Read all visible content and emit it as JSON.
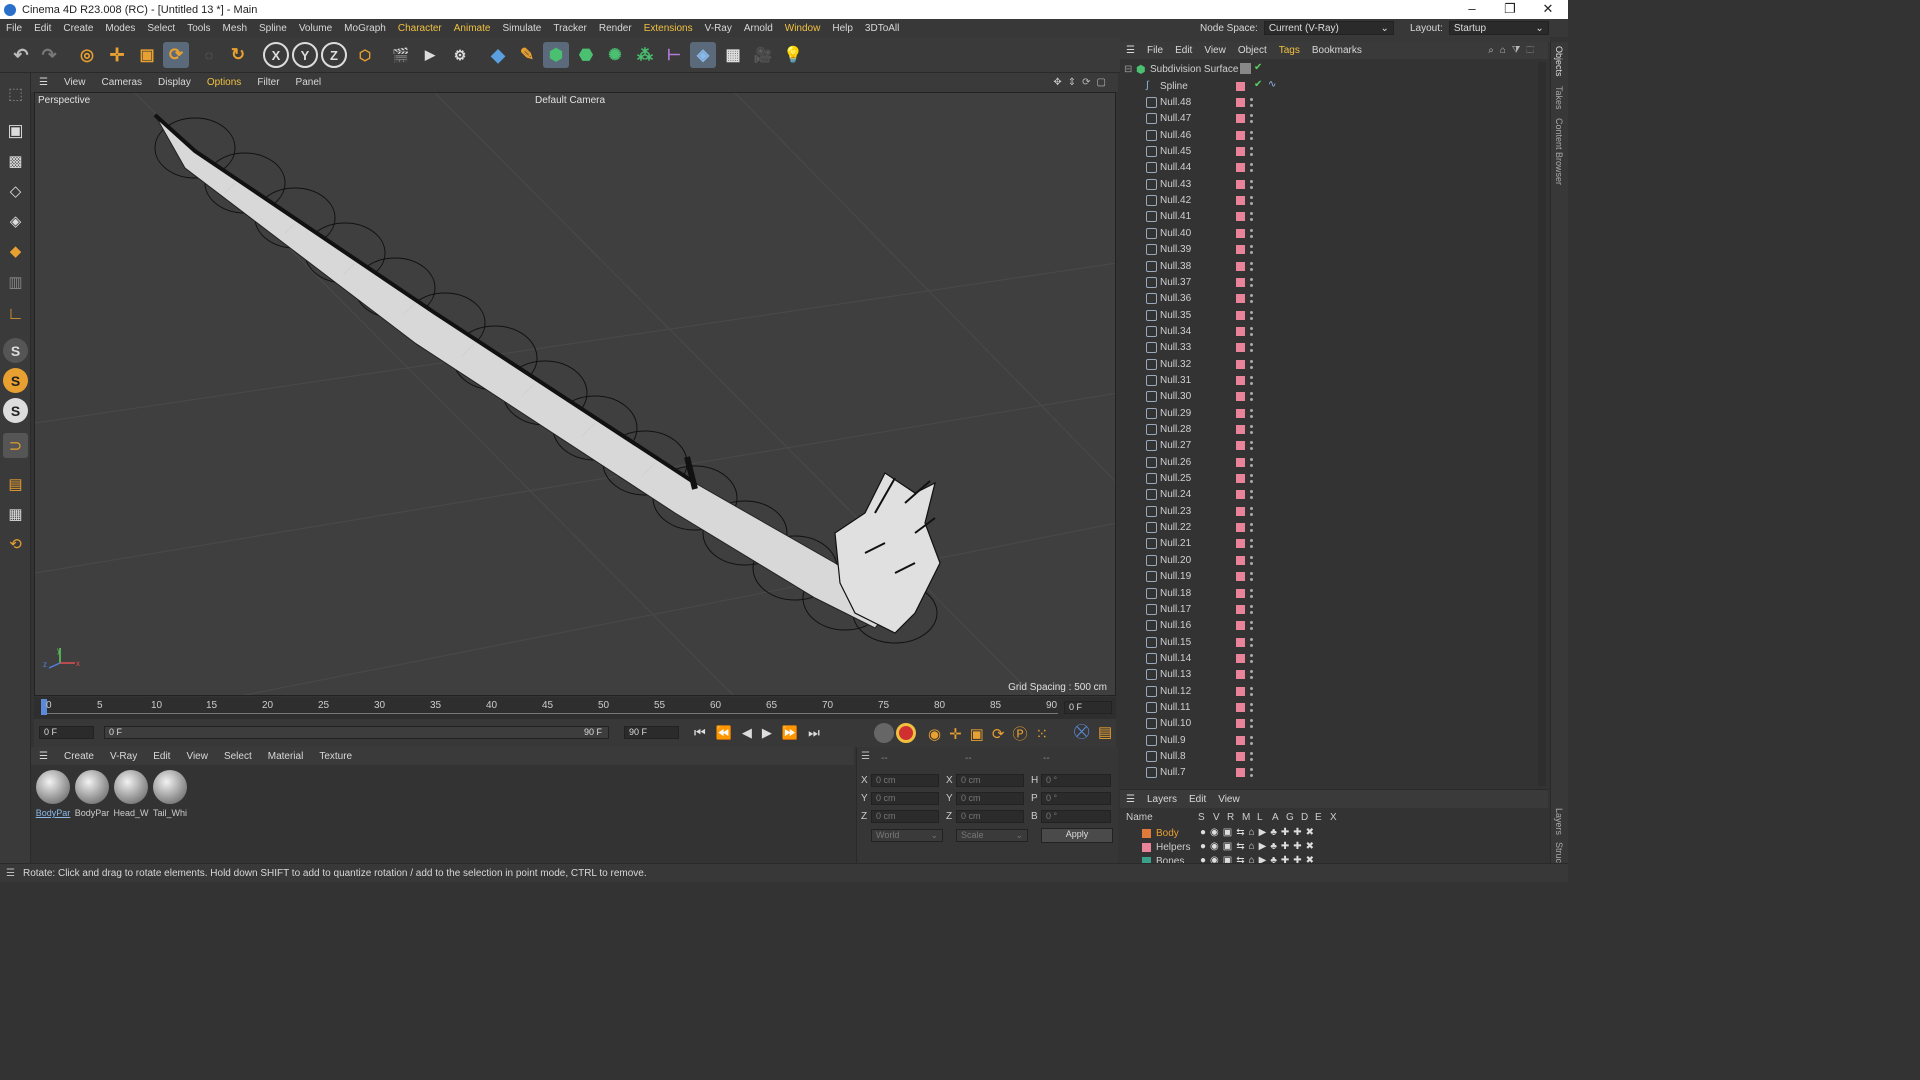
{
  "window": {
    "title": "Cinema 4D R23.008 (RC) - [Untitled 13 *] - Main"
  },
  "menu": [
    "File",
    "Edit",
    "Create",
    "Modes",
    "Select",
    "Tools",
    "Mesh",
    "Spline",
    "Volume",
    "MoGraph",
    "Character",
    "Animate",
    "Simulate",
    "Tracker",
    "Render",
    "Extensions",
    "V-Ray",
    "Arnold",
    "Window",
    "Help",
    "3DToAll"
  ],
  "node_space": {
    "label": "Node Space:",
    "value": "Current (V-Ray)"
  },
  "layout": {
    "label": "Layout:",
    "value": "Startup"
  },
  "viewport": {
    "menu": [
      "View",
      "Cameras",
      "Display",
      "Options",
      "Filter",
      "Panel"
    ],
    "name": "Perspective",
    "camera": "Default Camera",
    "grid_spacing": "Grid Spacing : 500 cm"
  },
  "timeline": {
    "ticks": [
      "0",
      "5",
      "10",
      "15",
      "20",
      "25",
      "30",
      "35",
      "40",
      "45",
      "50",
      "55",
      "60",
      "65",
      "70",
      "75",
      "80",
      "85",
      "90"
    ],
    "current_frame": "0 F",
    "start_field": "0 F",
    "range_start": "0 F",
    "range_end": "90 F",
    "end_field": "90 F"
  },
  "materials": {
    "menu": [
      "Create",
      "V-Ray",
      "Edit",
      "View",
      "Select",
      "Material",
      "Texture"
    ],
    "items": [
      "BodyPar",
      "BodyPar",
      "Head_W",
      "Tail_Whi"
    ]
  },
  "coords": {
    "headers": [
      "--",
      "--",
      "--"
    ],
    "rows": [
      {
        "a": "X",
        "av": "0 cm",
        "b": "X",
        "bv": "0 cm",
        "c": "H",
        "cv": "0 °"
      },
      {
        "a": "Y",
        "av": "0 cm",
        "b": "Y",
        "bv": "0 cm",
        "c": "P",
        "cv": "0 °"
      },
      {
        "a": "Z",
        "av": "0 cm",
        "b": "Z",
        "bv": "0 cm",
        "c": "B",
        "cv": "0 °"
      }
    ],
    "mode": "World",
    "scale": "Scale",
    "apply": "Apply"
  },
  "objects": {
    "menu": [
      "File",
      "Edit",
      "View",
      "Object",
      "Tags",
      "Bookmarks"
    ],
    "root": "Subdivision Surface",
    "spline": "Spline",
    "nulls": [
      "Null.48",
      "Null.47",
      "Null.46",
      "Null.45",
      "Null.44",
      "Null.43",
      "Null.42",
      "Null.41",
      "Null.40",
      "Null.39",
      "Null.38",
      "Null.37",
      "Null.36",
      "Null.35",
      "Null.34",
      "Null.33",
      "Null.32",
      "Null.31",
      "Null.30",
      "Null.29",
      "Null.28",
      "Null.27",
      "Null.26",
      "Null.25",
      "Null.24",
      "Null.23",
      "Null.22",
      "Null.21",
      "Null.20",
      "Null.19",
      "Null.18",
      "Null.17",
      "Null.16",
      "Null.15",
      "Null.14",
      "Null.13",
      "Null.12",
      "Null.11",
      "Null.10",
      "Null.9",
      "Null.8",
      "Null.7"
    ]
  },
  "side_tabs": [
    "Objects",
    "Takes",
    "Content Browser",
    "Layers",
    "Struc"
  ],
  "layers": {
    "menu": [
      "Layers",
      "Edit",
      "View"
    ],
    "header_name": "Name",
    "columns": [
      "S",
      "V",
      "R",
      "M",
      "L",
      "A",
      "G",
      "D",
      "E",
      "X"
    ],
    "items": [
      {
        "name": "Body",
        "color": "#e07a3a"
      },
      {
        "name": "Helpers",
        "color": "#e8839a"
      },
      {
        "name": "Bones",
        "color": "#3aa08a"
      }
    ]
  },
  "status": "Rotate: Click and drag to rotate elements. Hold down SHIFT to add to quantize rotation / add to the selection in point mode, CTRL to remove."
}
